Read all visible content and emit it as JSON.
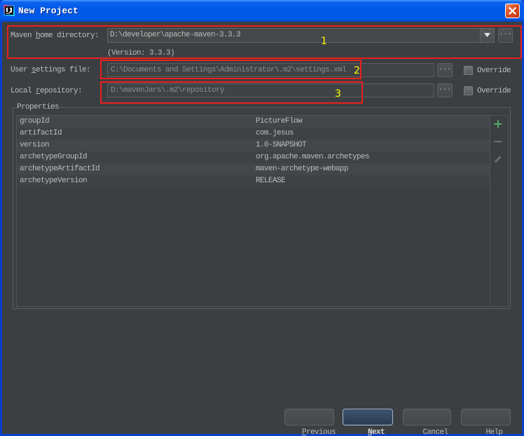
{
  "window": {
    "title": "New Project",
    "app_icon": "intellij-icon",
    "close_icon": "close-icon"
  },
  "maven_home": {
    "label": "Maven home directory:",
    "value": "D:\\developer\\apache-maven-3.3.3",
    "version": "(Version: 3.3.3)",
    "browse_label": "...",
    "dropdown_icon": "triangle-down-icon"
  },
  "user_settings": {
    "label": "User settings file:",
    "value": "C:\\Documents and Settings\\Administrator\\.m2\\settings.xml",
    "browse_label": "...",
    "override_label": "Override",
    "override_checked": false
  },
  "local_repository": {
    "label": "Local repository:",
    "value": "D:\\mavenJars\\.m2\\repository",
    "browse_label": "...",
    "override_label": "Override",
    "override_checked": false
  },
  "properties": {
    "title": "Properties",
    "rows": [
      {
        "key": "groupId",
        "value": "PictureFlow"
      },
      {
        "key": "artifactId",
        "value": "com.jesus"
      },
      {
        "key": "version",
        "value": "1.0-SNAPSHOT"
      },
      {
        "key": "archetypeGroupId",
        "value": "org.apache.maven.archetypes"
      },
      {
        "key": "archetypeArtifactId",
        "value": "maven-archetype-webapp"
      },
      {
        "key": "archetypeVersion",
        "value": "RELEASE"
      }
    ],
    "toolbar_icons": [
      "plus-icon",
      "minus-icon",
      "pencil-icon"
    ]
  },
  "annotations": [
    "1",
    "2",
    "3"
  ],
  "buttons": {
    "previous": "Previous",
    "next": "Next",
    "cancel": "Cancel",
    "help": "Help"
  },
  "colors": {
    "annotation_red": "#e8201e",
    "annotation_yellow": "#ffff00",
    "add_green": "#59a869",
    "dialog_background": "#3c3f41"
  }
}
